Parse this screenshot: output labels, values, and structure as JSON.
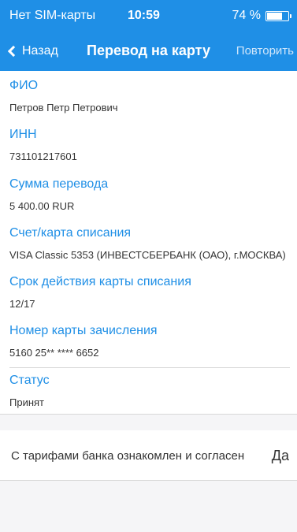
{
  "status_bar": {
    "carrier": "Нет SIM-карты",
    "time": "10:59",
    "battery": "74 %",
    "battery_level": 0.74
  },
  "nav": {
    "back_label": "Назад",
    "title": "Перевод на карту",
    "repeat_label": "Повторить"
  },
  "fields": [
    {
      "label": "ФИО",
      "value": "Петров Петр Петрович"
    },
    {
      "label": "ИНН",
      "value": "731101217601"
    },
    {
      "label": "Сумма перевода",
      "value": "5 400.00 RUR"
    },
    {
      "label": "Счет/карта списания",
      "value": "VISA Classic 5353 (ИНВЕСТСБЕРБАНК (ОАО), г.МОСКВА)"
    },
    {
      "label": "Срок действия карты списания",
      "value": "12/17"
    },
    {
      "label": "Номер карты зачисления",
      "value": "5160 25** **** 6652"
    },
    {
      "label": "Статус",
      "value": "Принят"
    }
  ],
  "agreement": {
    "text": "С тарифами банка ознакомлен и согласен",
    "answer": "Да"
  },
  "colors": {
    "accent": "#1f8fe6",
    "background": "#f5f5f7"
  }
}
